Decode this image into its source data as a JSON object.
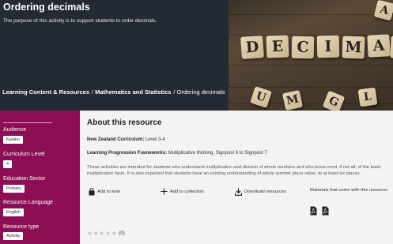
{
  "hero": {
    "title": "Ordering decimals",
    "subtitle": "The purpose of this activity is to support students to order decimals.",
    "breadcrumb": [
      "Learning Content & Resources",
      "Mathematics and Statistics",
      "Ordering decimals"
    ],
    "image_tiles": [
      "D",
      "E",
      "C",
      "I",
      "M",
      "A",
      "L",
      "U",
      "M",
      "G",
      "L",
      "A"
    ]
  },
  "sidebar": {
    "items": [
      {
        "label": "Audience",
        "value": "Kaiako"
      },
      {
        "label": "Curriculum Level",
        "value": "4"
      },
      {
        "label": "Education Sector",
        "value": "Primary"
      },
      {
        "label": "Resource Language",
        "value": "English"
      },
      {
        "label": "Resource type",
        "value": "Activity"
      }
    ]
  },
  "main": {
    "title": "About this resource",
    "curriculum_label": "New Zealand Curriculum:",
    "curriculum_value": "Level 3-4",
    "frameworks_label": "Learning Progression Frameworks:",
    "frameworks_value": "Multiplicative thinking, Signpost 6 to Signpost 7",
    "description": "These activities are intended for students who understand multiplication and division of whole numbers and who know most, if not all, of the basic multiplication facts. It is also expected that students have an existing understanding of whole number place value, to at least six places.",
    "actions": {
      "add_to_kete": "Add to kete",
      "add_to_collection": "Add to collection",
      "download": "Download resources"
    },
    "materials_text": "Materials that come with this resource:",
    "rating_count": "(0)"
  },
  "colors": {
    "hero_bg": "#232a33",
    "sidebar_bg": "#8c0f55",
    "main_bg": "#f3f3f3"
  }
}
